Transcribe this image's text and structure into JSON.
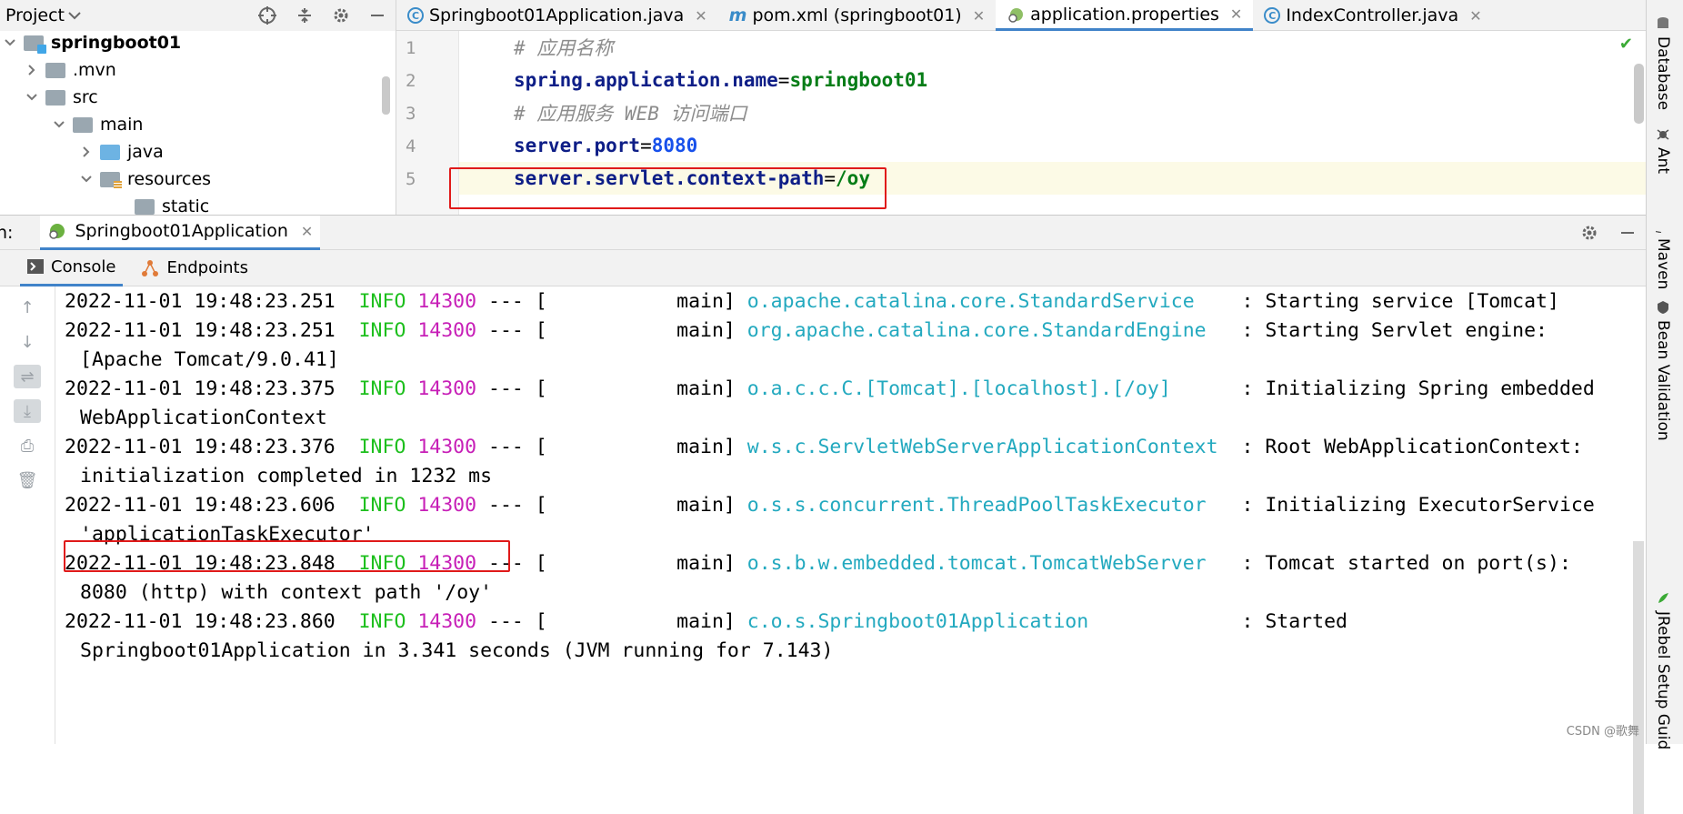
{
  "project_panel": {
    "title": "Project",
    "tree": [
      {
        "label": "springboot01",
        "bold": true
      },
      {
        "label": ".mvn"
      },
      {
        "label": "src"
      },
      {
        "label": "main"
      },
      {
        "label": "java"
      },
      {
        "label": "resources"
      },
      {
        "label": "static"
      }
    ]
  },
  "editor": {
    "tabs": [
      {
        "label": "Springboot01Application.java"
      },
      {
        "label": "pom.xml (springboot01)"
      },
      {
        "label": "application.properties"
      },
      {
        "label": "IndexController.java"
      }
    ],
    "active_tab": 2,
    "lines": [
      {
        "num": "1",
        "comment": "# 应用名称"
      },
      {
        "num": "2",
        "key": "spring.application.name",
        "eq": "=",
        "value": "springboot01"
      },
      {
        "num": "3",
        "comment": "# 应用服务 WEB 访问端口"
      },
      {
        "num": "4",
        "key": "server.port",
        "eq": "=",
        "value": "8080"
      },
      {
        "num": "5",
        "key": "server.servlet.context-path",
        "eq": "=",
        "value": "/oy"
      }
    ]
  },
  "run_panel": {
    "label": "n:",
    "run_tab": "Springboot01Application",
    "subtabs": [
      "Console",
      "Endpoints"
    ],
    "logs": [
      {
        "dt": "2022-11-01 19:48:23.251",
        "level": "INFO",
        "pid": "14300",
        "mid": " --- [           main] ",
        "cls": "o.apache.catalina.core.StandardService   ",
        "msg": " : Starting service [Tomcat]",
        "cont": ""
      },
      {
        "dt": "2022-11-01 19:48:23.251",
        "level": "INFO",
        "pid": "14300",
        "mid": " --- [           main] ",
        "cls": "org.apache.catalina.core.StandardEngine  ",
        "msg": " : Starting Servlet engine:",
        "cont": "[Apache Tomcat/9.0.41]"
      },
      {
        "dt": "2022-11-01 19:48:23.375",
        "level": "INFO",
        "pid": "14300",
        "mid": " --- [           main] ",
        "cls": "o.a.c.c.C.[Tomcat].[localhost].[/oy]     ",
        "msg": " : Initializing Spring embedded",
        "cont": "WebApplicationContext"
      },
      {
        "dt": "2022-11-01 19:48:23.376",
        "level": "INFO",
        "pid": "14300",
        "mid": " --- [           main] ",
        "cls": "w.s.c.ServletWebServerApplicationContext ",
        "msg": " : Root WebApplicationContext:",
        "cont": "initialization completed in 1232 ms"
      },
      {
        "dt": "2022-11-01 19:48:23.606",
        "level": "INFO",
        "pid": "14300",
        "mid": " --- [           main] ",
        "cls": "o.s.s.concurrent.ThreadPoolTaskExecutor  ",
        "msg": " : Initializing ExecutorService",
        "cont": "'applicationTaskExecutor'"
      },
      {
        "dt": "2022-11-01 19:48:23.848",
        "level": "INFO",
        "pid": "14300",
        "mid": " --- [           main] ",
        "cls": "o.s.b.w.embedded.tomcat.TomcatWebServer  ",
        "msg": " : Tomcat started on port(s):",
        "cont": "8080 (http) with context path '/oy'"
      },
      {
        "dt": "2022-11-01 19:48:23.860",
        "level": "INFO",
        "pid": "14300",
        "mid": " --- [           main] ",
        "cls": "c.o.s.Springboot01Application            ",
        "msg": " : Started",
        "cont": "Springboot01Application in 3.341 seconds (JVM running for 7.143)"
      }
    ]
  },
  "right_bar": [
    "Database",
    "Ant",
    "Maven",
    "Bean Validation",
    "JRebel Setup Guid"
  ],
  "watermark": "CSDN @歌舞",
  "colors": {
    "accent": "#4083c9",
    "highlight": "#e01a1a",
    "info": "#1dbf1d",
    "pid": "#c71fb7",
    "logger": "#23a9bf"
  }
}
